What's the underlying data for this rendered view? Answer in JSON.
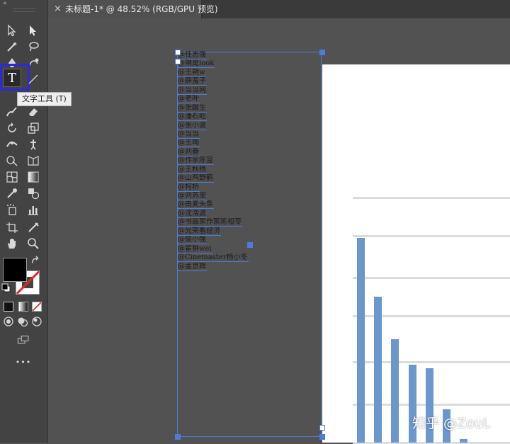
{
  "document_tab": {
    "close_icon": "×",
    "title": "未标题-1* @ 48.52% (RGB/GPU 预览)"
  },
  "toolbar": {
    "collapse_icon": "«",
    "active_tool": "type-tool",
    "type_tool_glyph": "T",
    "tooltip": "文字工具 (T)",
    "more_icon": "•••"
  },
  "text_frame": {
    "lines": [
      "@任志强",
      "@琳是iook",
      "@王朔w",
      "@薛蛮子",
      "@当当网",
      "@老叶",
      "@张醒生",
      "@潘石屹",
      "@张小波",
      "@当当",
      "@王珣",
      "@刘春",
      "@作家陈宣",
      "@王秋杨",
      "@山鸡野鹤",
      "@柯桥",
      "@刘苏里",
      "@由麦头条",
      "@沈浩波",
      "@书画家作家陈相苓",
      "@光荣看经济",
      "@侯小强",
      "@霍翀wei",
      "@Cinemaster杨小冬",
      "@孟京辉"
    ]
  },
  "chart_data": {
    "type": "bar",
    "categories": [],
    "values": [
      535,
      381,
      270,
      203,
      194,
      87,
      9
    ],
    "gridlines": [
      640,
      540,
      430,
      330,
      210,
      100,
      0
    ],
    "color": "#6a97cd"
  },
  "colors": {
    "canvas": "#525252",
    "toolbar": "#434343",
    "selection": "#4c7bd9",
    "highlight": "#2a2bd6",
    "bar": "#6a97cd"
  },
  "watermark": "知乎 @ZouL"
}
